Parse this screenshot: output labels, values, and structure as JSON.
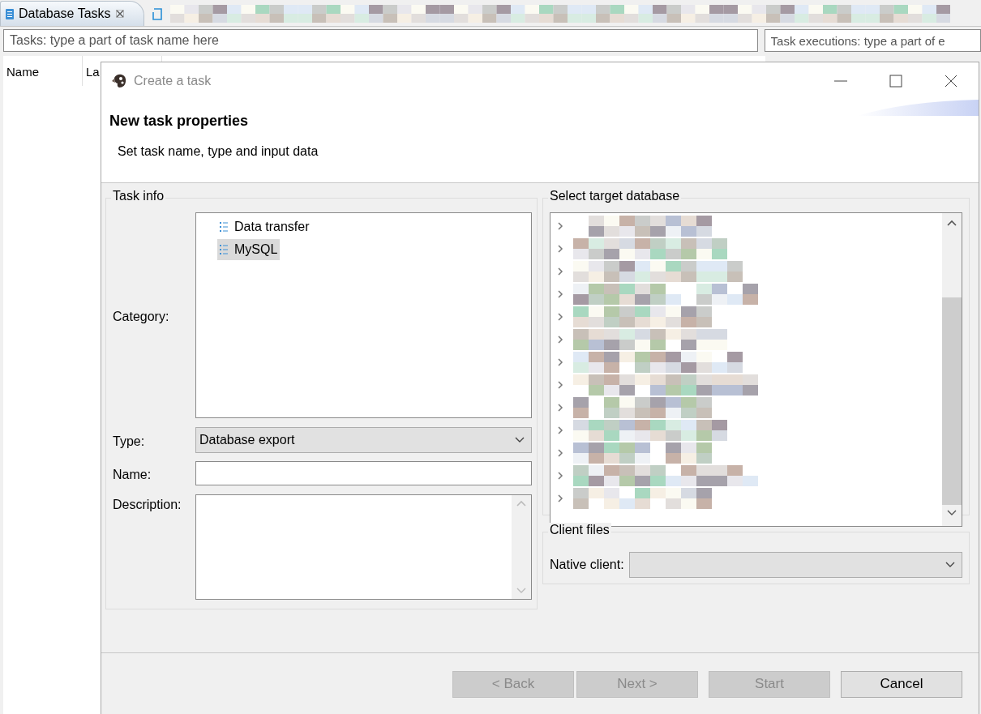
{
  "tabs": [
    {
      "label": "Database Tasks",
      "selected": true
    }
  ],
  "filters": [
    {
      "placeholder": "Tasks: type a part of task name here"
    },
    {
      "placeholder": "Task executions: type a part of e"
    }
  ],
  "table": {
    "columns": [
      "Name",
      "La"
    ]
  },
  "dialog": {
    "title": "Create a task",
    "heading": "New task properties",
    "subtitle": "Set task name, type and input data",
    "task_info": {
      "title": "Task info",
      "category_label": "Category:",
      "categories": [
        {
          "label": "Data transfer",
          "selected": false
        },
        {
          "label": "MySQL",
          "selected": true
        }
      ],
      "type_label": "Type:",
      "type_value": "Database export",
      "name_label": "Name:",
      "description_label": "Description:"
    },
    "target": {
      "title": "Select target database",
      "nodes": [
        {
          "expanded": false
        },
        {
          "expanded": false
        },
        {
          "expanded": false
        },
        {
          "expanded": false
        },
        {
          "expanded": false
        },
        {
          "expanded": false
        },
        {
          "expanded": false
        },
        {
          "expanded": false
        },
        {
          "expanded": false
        },
        {
          "expanded": false
        },
        {
          "expanded": false
        },
        {
          "expanded": false
        },
        {
          "expanded": false
        }
      ]
    },
    "client_files": {
      "title": "Client files",
      "native_client_label": "Native client:"
    },
    "buttons": [
      {
        "label": "< Back",
        "disabled": true
      },
      {
        "label": "Next >",
        "disabled": true
      },
      {
        "label": "Start",
        "disabled": true
      },
      {
        "label": "Cancel",
        "disabled": false
      }
    ]
  }
}
